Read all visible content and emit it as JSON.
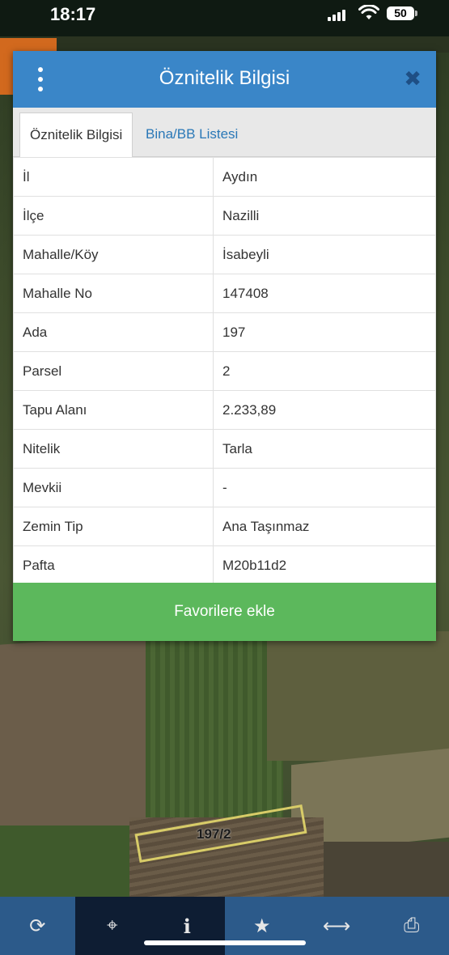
{
  "status_bar": {
    "time": "18:17",
    "battery": "50"
  },
  "dialog": {
    "title": "Öznitelik Bilgisi",
    "tabs": [
      {
        "label": "Öznitelik Bilgisi",
        "active": true
      },
      {
        "label": "Bina/BB Listesi",
        "active": false
      }
    ],
    "rows": [
      {
        "key": "İl",
        "value": "Aydın"
      },
      {
        "key": "İlçe",
        "value": "Nazilli"
      },
      {
        "key": "Mahalle/Köy",
        "value": "İsabeyli"
      },
      {
        "key": "Mahalle No",
        "value": "147408"
      },
      {
        "key": "Ada",
        "value": "197"
      },
      {
        "key": "Parsel",
        "value": "2"
      },
      {
        "key": "Tapu Alanı",
        "value": "2.233,89"
      },
      {
        "key": "Nitelik",
        "value": "Tarla"
      },
      {
        "key": "Mevkii",
        "value": "-"
      },
      {
        "key": "Zemin Tip",
        "value": "Ana Taşınmaz"
      },
      {
        "key": "Pafta",
        "value": "M20b11d2"
      }
    ],
    "favorite_button": "Favorilere ekle"
  },
  "map": {
    "parcel_label": "197/2"
  },
  "toolbar": {
    "items": [
      {
        "icon": "refresh-icon",
        "glyph": "⟳"
      },
      {
        "icon": "crosshair-icon",
        "glyph": "⌖"
      },
      {
        "icon": "info-icon",
        "glyph": "i"
      },
      {
        "icon": "star-icon",
        "glyph": "★"
      },
      {
        "icon": "measure-icon",
        "glyph": "⟷"
      },
      {
        "icon": "print-icon",
        "glyph": "⎙"
      }
    ]
  },
  "colors": {
    "header": "#3a86c8",
    "favorite": "#5cb85c",
    "toolbar": "#2c5a8a"
  }
}
